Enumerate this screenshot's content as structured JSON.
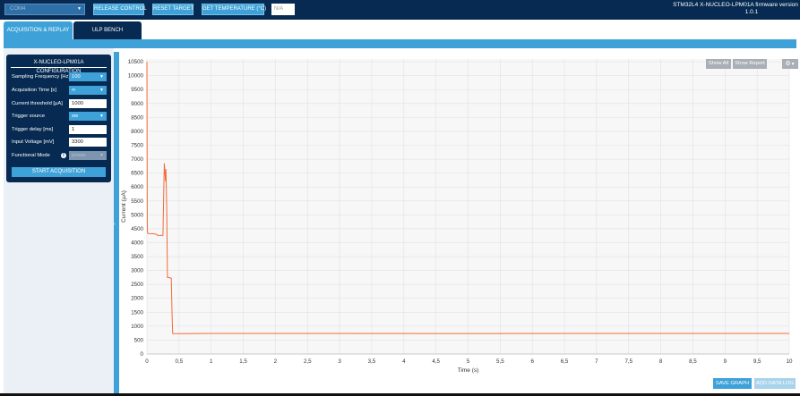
{
  "header": {
    "port_select_value": "COM4",
    "buttons": {
      "release": "RELEASE CONTROL",
      "reset": "RESET TARGET",
      "temperature": "GET TEMPERATURE (°C)"
    },
    "temperature_value": "N/A",
    "firmware_line1": "STM32L4 X-NUCLEO-LPM01A firmware version",
    "firmware_line2": "1.0.1"
  },
  "tabs": [
    {
      "label": "ACQUISITION & REPLAY",
      "active": true
    },
    {
      "label": "ULP BENCH",
      "active": false
    }
  ],
  "config": {
    "title": "X-NUCLEO-LPM01A CONFIGURATION",
    "sampling_frequency": {
      "label": "Sampling Frequency [Hz]",
      "value": "100"
    },
    "acquisition_time": {
      "label": "Acquisition Time [s]",
      "value": "∞"
    },
    "current_threshold": {
      "label": "Current threshold [µA]",
      "value": "1000"
    },
    "trigger_source": {
      "label": "Trigger source",
      "value": "sw"
    },
    "trigger_delay": {
      "label": "Trigger delay [ms]",
      "value": "1"
    },
    "input_voltage": {
      "label": "Input Voltage [mV]",
      "value": "3300"
    },
    "functional_mode": {
      "label": "Functional Mode",
      "value": "power"
    },
    "start_button": "START ACQUISITION"
  },
  "chart_controls": {
    "show_all": "Show All",
    "show_report": "Show Report",
    "save_graph": "SAVE GRAPH",
    "add_data_log": "ADD DATA LOG"
  },
  "colors": {
    "navy": "#062a52",
    "accent": "#3ea2d8",
    "series": "#f26b3a"
  },
  "chart_data": {
    "type": "line",
    "xlabel": "Time (s)",
    "ylabel": "Current (µA)",
    "xlim": [
      0,
      10
    ],
    "ylim": [
      0,
      10600
    ],
    "grid": true,
    "x_ticks": [
      0,
      0.5,
      1,
      1.5,
      2,
      2.5,
      3,
      3.5,
      4,
      4.5,
      5,
      5.5,
      6,
      6.5,
      7,
      7.5,
      8,
      8.5,
      9,
      9.5,
      10
    ],
    "x_tick_labels": [
      "0",
      "0,5",
      "1",
      "1,5",
      "2",
      "2,5",
      "3",
      "3,5",
      "4",
      "4,5",
      "5",
      "5,5",
      "6",
      "6,5",
      "7",
      "7,5",
      "8",
      "8,5",
      "9",
      "9,5",
      "10"
    ],
    "y_ticks": [
      0,
      500,
      1000,
      1500,
      2000,
      2500,
      3000,
      3500,
      4000,
      4500,
      5000,
      5500,
      6000,
      6500,
      7000,
      7500,
      8000,
      8500,
      9000,
      9500,
      10000,
      10500
    ],
    "series": [
      {
        "x": [
          0,
          0.005,
          0.01,
          0.02,
          0.1,
          0.15,
          0.16,
          0.17,
          0.25,
          0.27,
          0.29,
          0.295,
          0.3,
          0.31,
          0.32,
          0.33,
          0.34,
          0.38,
          0.39,
          0.4,
          0.42,
          1,
          3,
          5,
          7,
          9,
          10
        ],
        "y": [
          10500,
          4700,
          4350,
          4330,
          4320,
          4300,
          4270,
          4260,
          4260,
          6850,
          6200,
          6650,
          6250,
          5000,
          2750,
          2750,
          2750,
          2720,
          1500,
          740,
          730,
          740,
          740,
          735,
          740,
          738,
          740
        ]
      }
    ]
  }
}
